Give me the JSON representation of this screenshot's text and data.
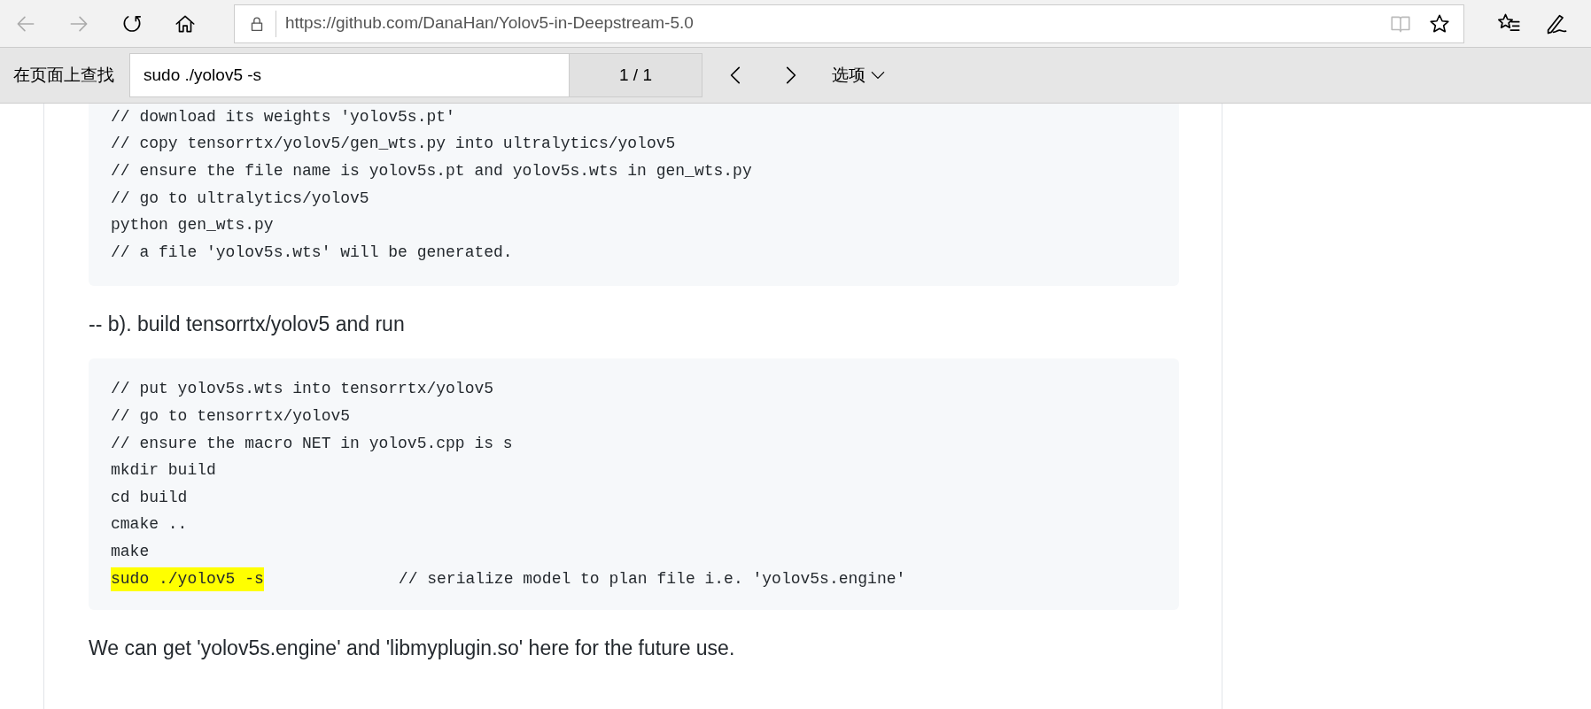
{
  "toolbar": {
    "back_disabled": true,
    "forward_disabled": true,
    "url": "https://github.com/DanaHan/Yolov5-in-Deepstream-5.0"
  },
  "find_bar": {
    "label": "在页面上查找",
    "query": "sudo ./yolov5 -s",
    "count": "1 / 1",
    "options": "选项"
  },
  "content": [
    {
      "kind": "code",
      "lines": [
        [
          {
            "text": "// download its weights 'yolov5s.pt'",
            "highlighted": false
          }
        ],
        [
          {
            "text": "// copy tensorrtx/yolov5/gen_wts.py into ultralytics/yolov5",
            "highlighted": false
          }
        ],
        [
          {
            "text": "// ensure the file name is yolov5s.pt and yolov5s.wts in gen_wts.py",
            "highlighted": false
          }
        ],
        [
          {
            "text": "// go to ultralytics/yolov5",
            "highlighted": false
          }
        ],
        [
          {
            "text": "python gen_wts.py",
            "highlighted": false
          }
        ],
        [
          {
            "text": "// a file 'yolov5s.wts' will be generated.",
            "highlighted": false
          }
        ]
      ]
    },
    {
      "kind": "paragraph",
      "text": "-- b). build tensorrtx/yolov5 and run"
    },
    {
      "kind": "code",
      "lines": [
        [
          {
            "text": "// put yolov5s.wts into tensorrtx/yolov5",
            "highlighted": false
          }
        ],
        [
          {
            "text": "// go to tensorrtx/yolov5",
            "highlighted": false
          }
        ],
        [
          {
            "text": "// ensure the macro NET in yolov5.cpp is s",
            "highlighted": false
          }
        ],
        [
          {
            "text": "mkdir build",
            "highlighted": false
          }
        ],
        [
          {
            "text": "cd build",
            "highlighted": false
          }
        ],
        [
          {
            "text": "cmake ..",
            "highlighted": false
          }
        ],
        [
          {
            "text": "make",
            "highlighted": false
          }
        ],
        [
          {
            "text": "sudo ./yolov5 -s",
            "highlighted": true
          },
          {
            "text": "// serialize model to plan file i.e. 'yolov5s.engine'",
            "highlighted": false
          }
        ]
      ]
    },
    {
      "kind": "paragraph",
      "text": "We can get 'yolov5s.engine' and 'libmyplugin.so' here for the future use."
    }
  ]
}
